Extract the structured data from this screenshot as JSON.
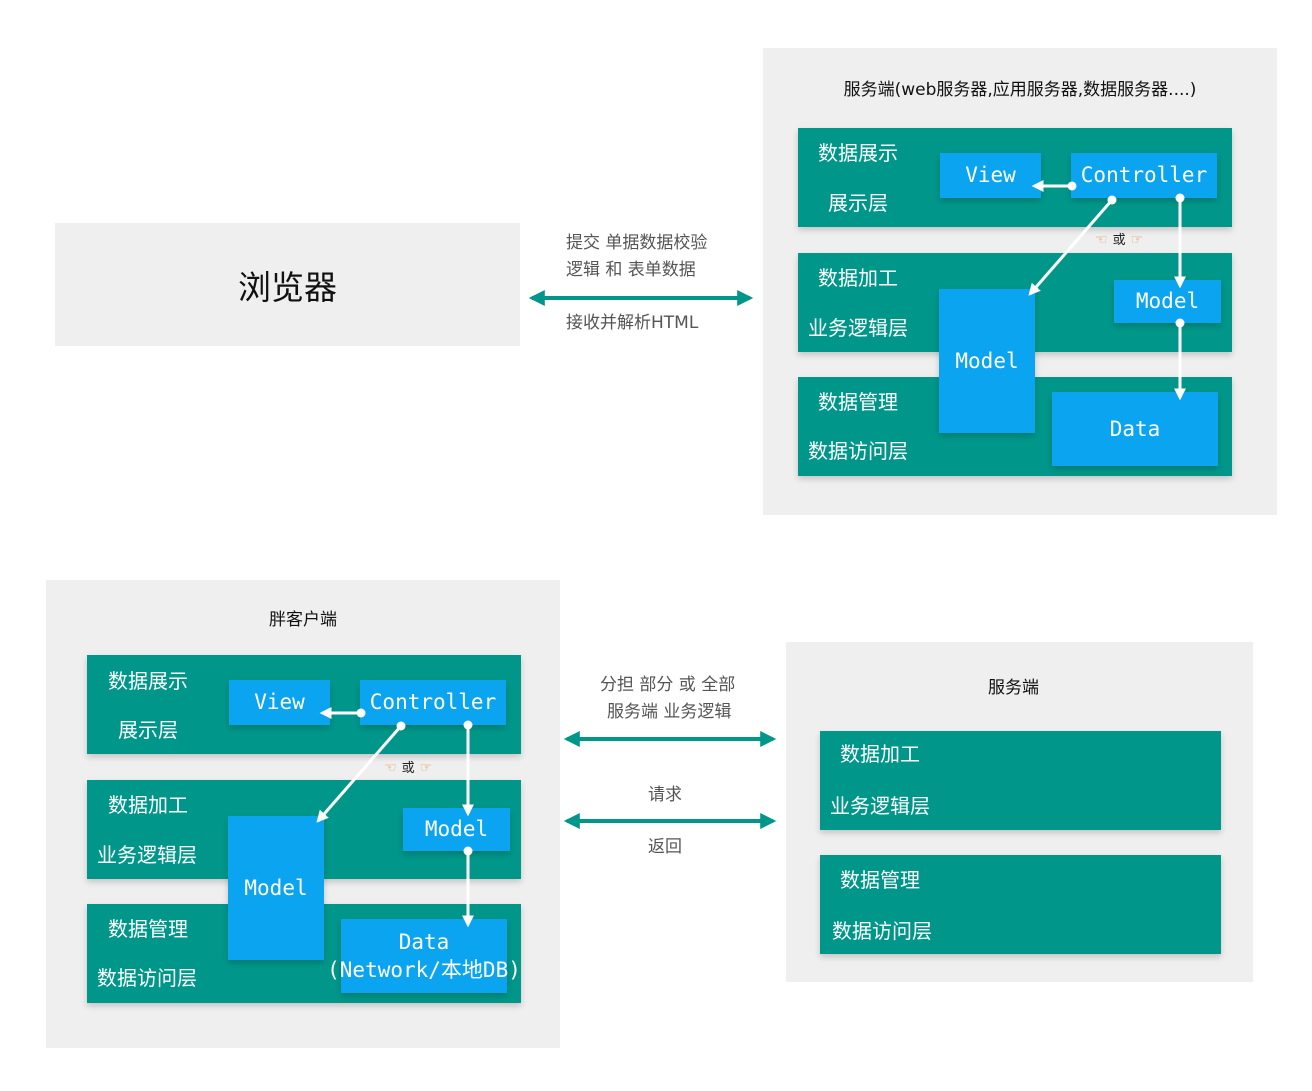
{
  "browser": {
    "label": "浏览器"
  },
  "exchange_top": {
    "line1": "提交  单据数据校验",
    "line2": "逻辑  和  表单数据",
    "line3": "接收并解析HTML"
  },
  "server_top": {
    "title": "服务端(web服务器,应用服务器,数据服务器....)",
    "layers": [
      {
        "name": "数据展示",
        "layer": "展示层"
      },
      {
        "name": "数据加工",
        "layer": "业务逻辑层"
      },
      {
        "name": "数据管理",
        "layer": "数据访问层"
      }
    ],
    "blocks": {
      "view": "View",
      "controller": "Controller",
      "model_small": "Model",
      "model_big": "Model",
      "data": "Data"
    },
    "or_label": "或"
  },
  "fat_client": {
    "title": "胖客户端",
    "layers": [
      {
        "name": "数据展示",
        "layer": "展示层"
      },
      {
        "name": "数据加工",
        "layer": "业务逻辑层"
      },
      {
        "name": "数据管理",
        "layer": "数据访问层"
      }
    ],
    "blocks": {
      "view": "View",
      "controller": "Controller",
      "model_small": "Model",
      "model_big": "Model",
      "data_line1": "Data",
      "data_line2": "(Network/本地DB)"
    },
    "or_label": "或"
  },
  "exchange_bottom": {
    "line1": "分担 部分 或 全部",
    "line2": "服务端 业务逻辑",
    "request": "请求",
    "response": "返回"
  },
  "server_bottom": {
    "title": "服务端",
    "layers": [
      {
        "name": "数据加工",
        "layer": "业务逻辑层"
      },
      {
        "name": "数据管理",
        "layer": "数据访问层"
      }
    ]
  },
  "colors": {
    "panel": "#efefef",
    "band": "#00978a",
    "block": "#0aa4f0",
    "exchange_arrow": "#00978a",
    "flow_arrow": "#ffffff"
  }
}
